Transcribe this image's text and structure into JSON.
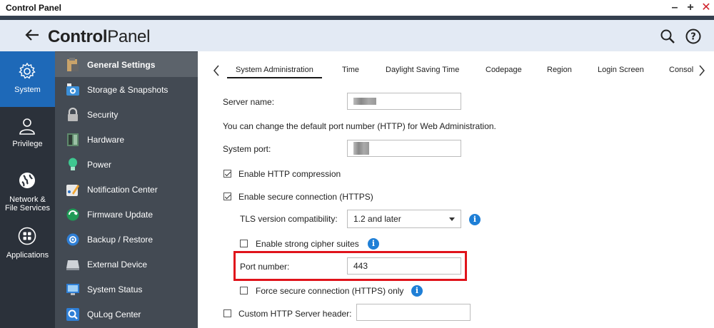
{
  "window": {
    "title": "Control Panel"
  },
  "header": {
    "title_part1": "Control",
    "title_part2": "Panel"
  },
  "rail": [
    {
      "label": "System",
      "icon": "gear-icon"
    },
    {
      "label": "Privilege",
      "icon": "user-icon"
    },
    {
      "label_line1": "Network &",
      "label_line2": "File Services",
      "icon": "globe-icon"
    },
    {
      "label": "Applications",
      "icon": "apps-grid-icon"
    }
  ],
  "sidebar": [
    {
      "label": "General Settings"
    },
    {
      "label": "Storage & Snapshots"
    },
    {
      "label": "Security"
    },
    {
      "label": "Hardware"
    },
    {
      "label": "Power"
    },
    {
      "label": "Notification Center"
    },
    {
      "label": "Firmware Update"
    },
    {
      "label": "Backup / Restore"
    },
    {
      "label": "External Device"
    },
    {
      "label": "System Status"
    },
    {
      "label": "QuLog Center"
    }
  ],
  "tabs": [
    {
      "label": "System Administration"
    },
    {
      "label": "Time"
    },
    {
      "label": "Daylight Saving Time"
    },
    {
      "label": "Codepage"
    },
    {
      "label": "Region"
    },
    {
      "label": "Login Screen"
    },
    {
      "label": "Consol"
    }
  ],
  "form": {
    "server_name_label": "Server name:",
    "port_note": "You can change the default port number (HTTP) for Web Administration.",
    "system_port_label": "System port:",
    "http_compression_label": "Enable HTTP compression",
    "https_label": "Enable secure connection (HTTPS)",
    "tls_label": "TLS version compatibility:",
    "tls_value": "1.2 and later",
    "strong_cipher_label": "Enable strong cipher suites",
    "port_number_label": "Port number:",
    "port_number_value": "443",
    "force_https_label": "Force secure connection (HTTPS) only",
    "custom_header_label": "Custom HTTP Server header:"
  },
  "colors": {
    "accent": "#1e69b8",
    "highlight": "#e0131b",
    "info": "#1f7fd6"
  }
}
